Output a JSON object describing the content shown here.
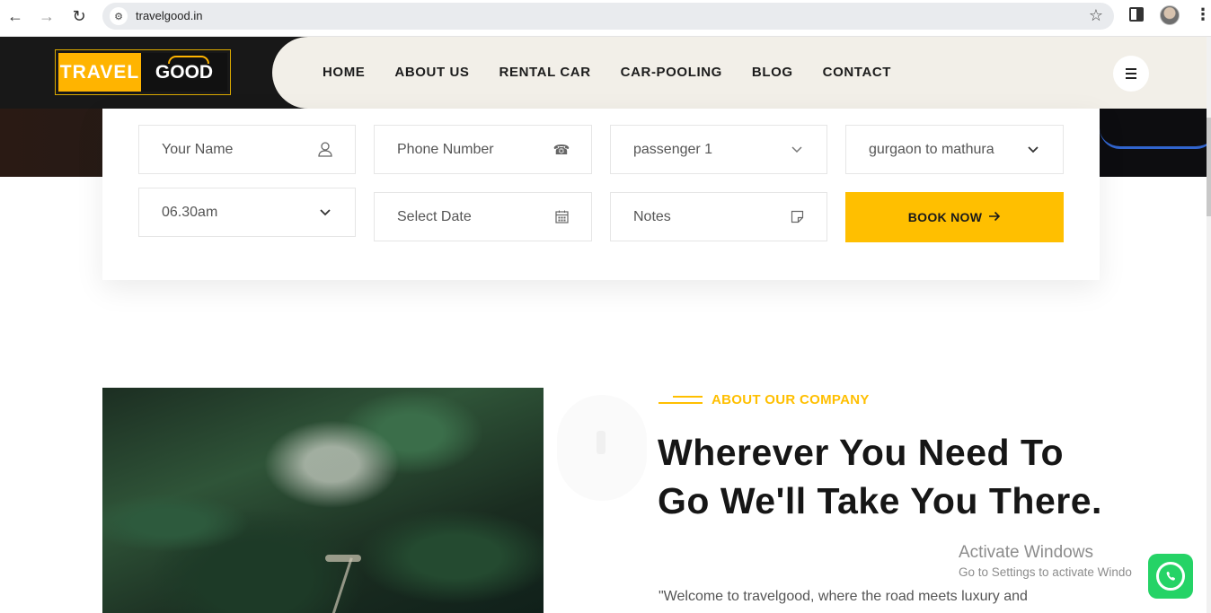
{
  "browser": {
    "url": "travelgood.in",
    "back_icon": "arrow-left-icon",
    "forward_icon": "arrow-right-icon",
    "reload_icon": "reload-icon",
    "star_icon": "star-icon"
  },
  "header": {
    "logo_left": "TRAVEL",
    "logo_right": "GOOD",
    "nav": [
      "HOME",
      "ABOUT US",
      "RENTAL CAR",
      "CAR-POOLING",
      "BLOG",
      "CONTACT"
    ]
  },
  "booking": {
    "name_placeholder": "Your Name",
    "phone_placeholder": "Phone Number",
    "passenger_value": "passenger 1",
    "route_value": "gurgaon to mathura",
    "time_value": "06.30am",
    "date_placeholder": "Select Date",
    "notes_placeholder": "Notes",
    "book_button": "BOOK NOW"
  },
  "about": {
    "eyebrow": "ABOUT OUR COMPANY",
    "headline": "Wherever You Need To Go We'll Take You There.",
    "intro": "\"Welcome to travelgood, where the road meets luxury and"
  },
  "overlay": {
    "activate_title": "Activate Windows",
    "activate_sub": "Go to Settings to activate Windo"
  },
  "colors": {
    "accent": "#ffbf00",
    "header_dark": "#181818",
    "header_light": "#f2efe8",
    "whatsapp": "#25d366"
  }
}
